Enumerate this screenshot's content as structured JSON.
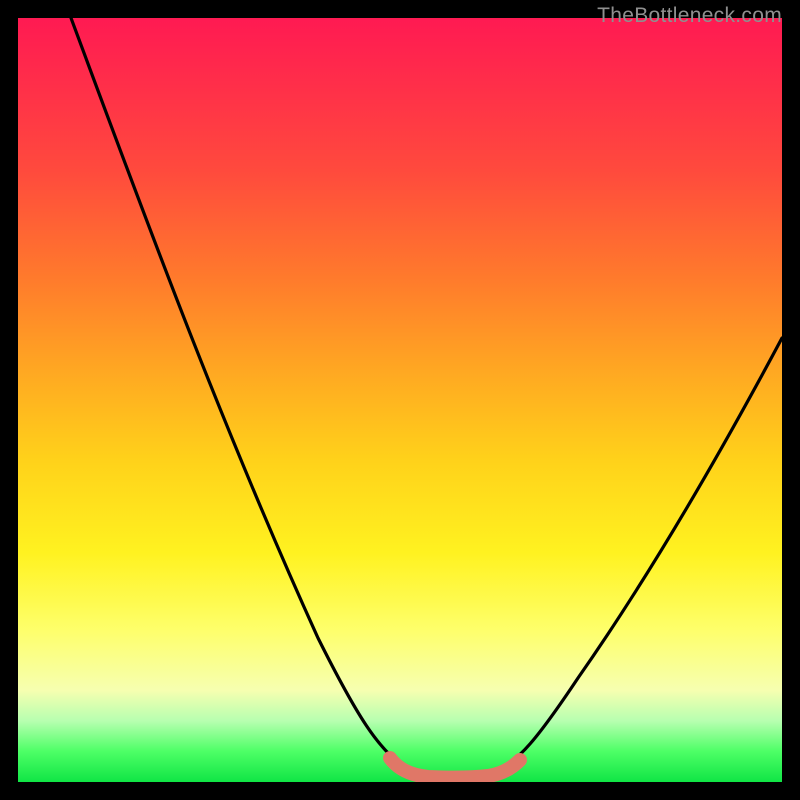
{
  "watermark": {
    "text": "TheBottleneck.com"
  },
  "chart_data": {
    "type": "line",
    "title": "",
    "xlabel": "",
    "ylabel": "",
    "xlim": [
      0,
      100
    ],
    "ylim": [
      0,
      100
    ],
    "x": [
      7,
      12,
      17,
      22,
      27,
      32,
      37,
      42,
      46,
      49,
      52,
      55,
      58,
      61,
      64,
      68,
      74,
      80,
      86,
      92,
      98,
      100
    ],
    "values": [
      100,
      88,
      76,
      65,
      54,
      43,
      33,
      23,
      14,
      8,
      3.5,
      1.2,
      0.6,
      0.6,
      1.4,
      4.5,
      12,
      22,
      32,
      43,
      55,
      59
    ],
    "trough_band": {
      "x_start": 49,
      "x_end": 64,
      "y": 0.8
    },
    "gradient_stops": [
      {
        "pos": 0,
        "color": "#ff1a52"
      },
      {
        "pos": 20,
        "color": "#ff4a3d"
      },
      {
        "pos": 46,
        "color": "#ffa722"
      },
      {
        "pos": 70,
        "color": "#fff220"
      },
      {
        "pos": 88,
        "color": "#f6ffb0"
      },
      {
        "pos": 100,
        "color": "#10e545"
      }
    ]
  }
}
